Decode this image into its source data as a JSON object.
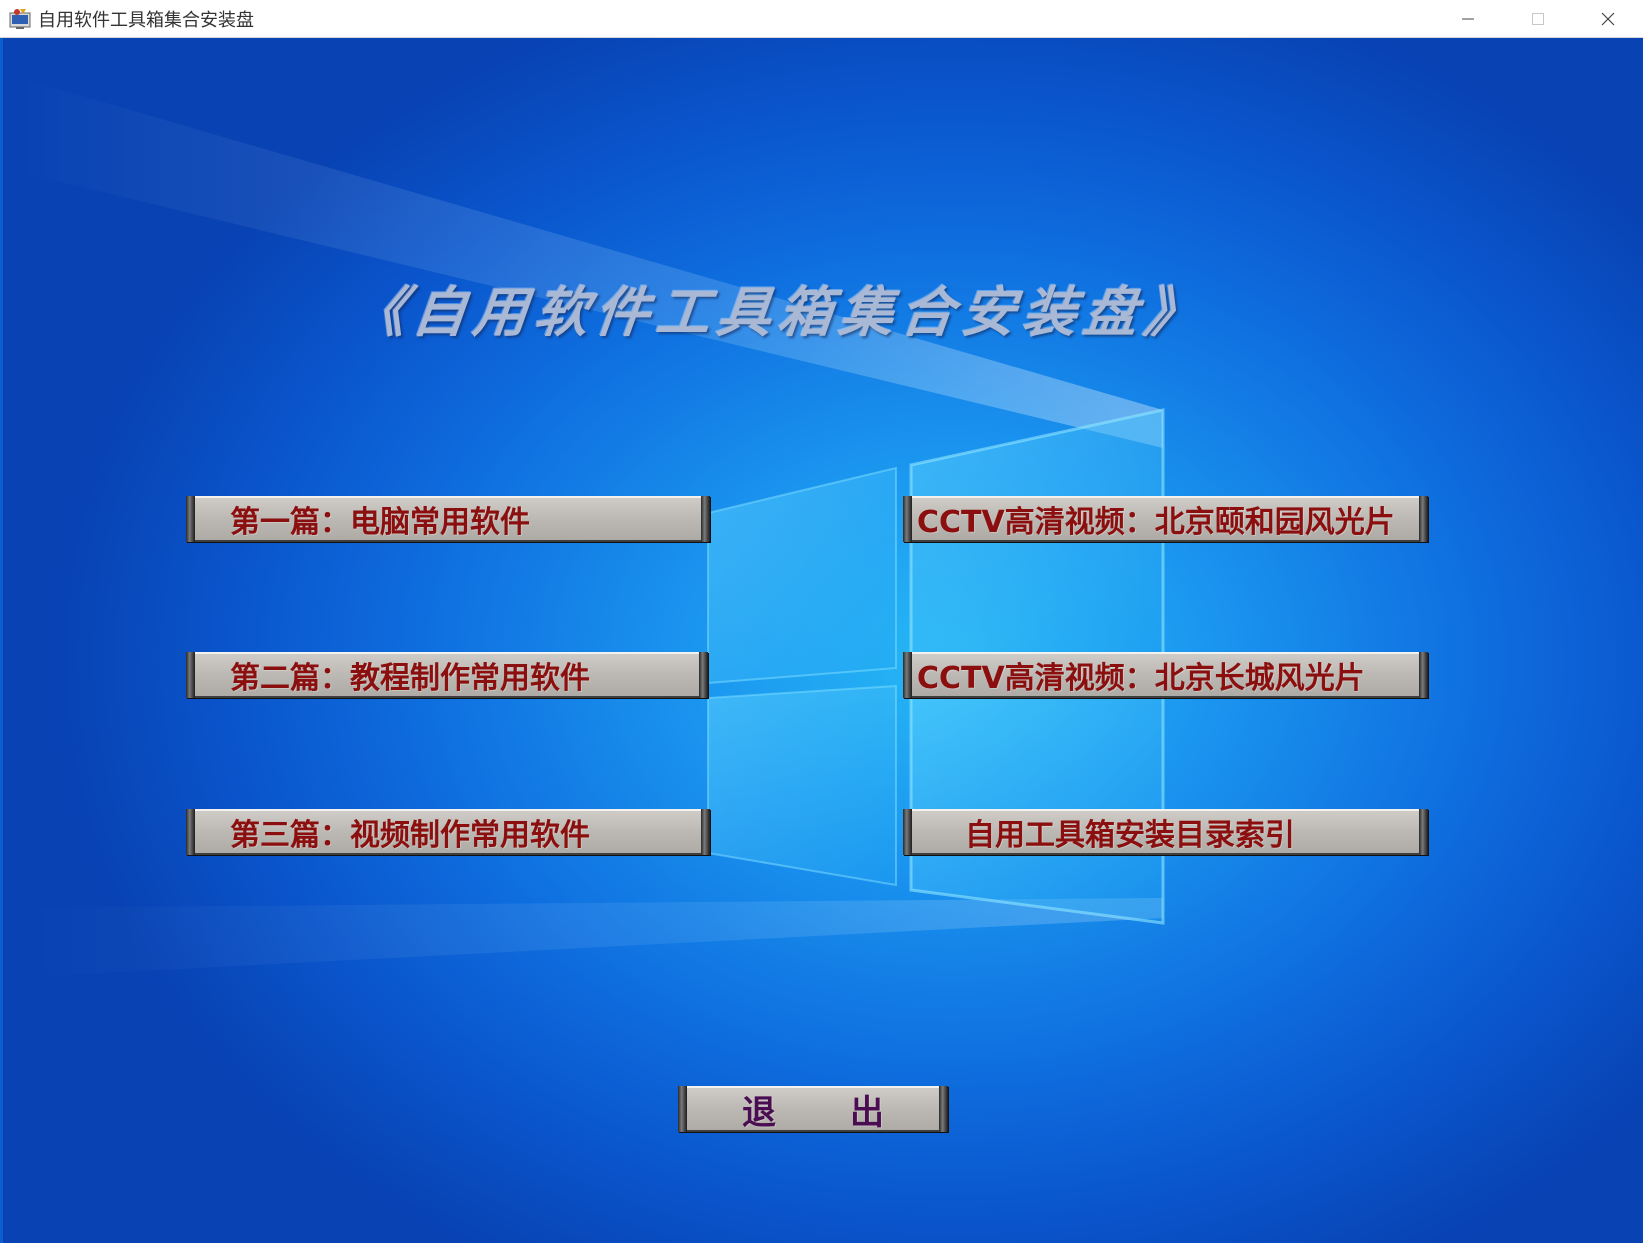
{
  "window": {
    "title": "自用软件工具箱集合安装盘"
  },
  "heading": {
    "text": "《自用软件工具箱集合安装盘》"
  },
  "buttons": {
    "left": [
      {
        "label": "第一篇：电脑常用软件"
      },
      {
        "label": "第二篇：教程制作常用软件"
      },
      {
        "label": "第三篇：视频制作常用软件"
      }
    ],
    "right": [
      {
        "label": "CCTV高清视频：北京颐和园风光片"
      },
      {
        "label": "CCTV高清视频：北京长城风光片"
      },
      {
        "label": "自用工具箱安装目录索引"
      }
    ],
    "exit": {
      "label_first": "退",
      "label_second": "出"
    }
  },
  "colors": {
    "button_text": "#8b0f0f",
    "exit_text": "#4a0d52",
    "heading_text": "#a9b8d4",
    "background": "#0a5fd0"
  },
  "icons": {
    "app": "app-icon",
    "minimize": "minimize-icon",
    "maximize": "maximize-icon",
    "close": "close-icon"
  }
}
